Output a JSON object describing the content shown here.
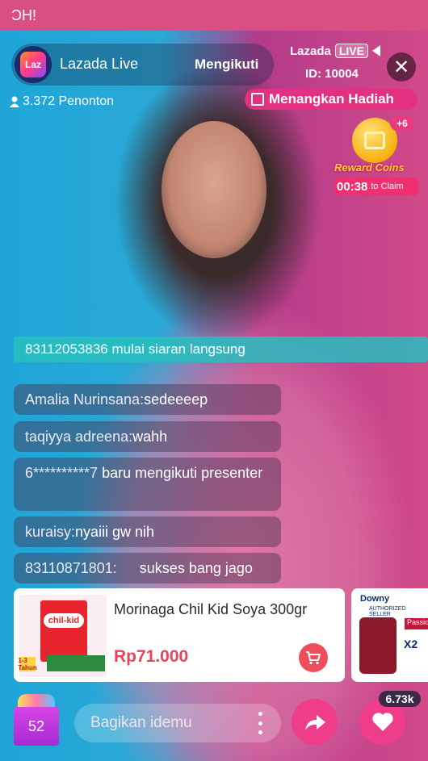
{
  "status_bar": {
    "text": "ϽH!"
  },
  "host": {
    "logo_text": "Laz",
    "name": "Lazada Live",
    "follow_label": "Mengikuti"
  },
  "brand": {
    "name": "Lazada",
    "live_badge": "LIVE",
    "id_text": "ID: 10004"
  },
  "viewers": {
    "text": "3.372 Penonton"
  },
  "prize": {
    "label": "Menangkan Hadiah"
  },
  "reward": {
    "plus": "+6",
    "title": "Reward Coins",
    "timer": "00:38",
    "claim_text": "to Claim"
  },
  "banner": {
    "text": "83112053836 mulai siaran langsung"
  },
  "comments": [
    {
      "user": "Amalia Nurinsana:",
      "text": "sedeeeep"
    },
    {
      "user": "taqiyya adreena:",
      "text": "wahh"
    },
    {
      "user": "6**********7",
      "text": " baru mengikuti presenter"
    },
    {
      "user": "kuraisy:",
      "text": "nyaiii gw nih"
    },
    {
      "user": "83110871801:",
      "text": "sukses bang jago"
    }
  ],
  "product": {
    "title": "Morinaga Chil Kid Soya 300gr",
    "price": "Rp71.000",
    "box_label": "chil-kid",
    "box_age": "1-3 Tahun"
  },
  "product2": {
    "brand": "Downy",
    "sub": "AUTHORIZED SELLER",
    "tag": "Passio",
    "qty": "X2"
  },
  "bottom": {
    "bag_count": "52",
    "input_placeholder": "Bagikan idemu",
    "like_count": "6.73k"
  },
  "colors": {
    "accent": "#ef3d8a",
    "price": "#e9445d",
    "banner": "#28bebe"
  }
}
